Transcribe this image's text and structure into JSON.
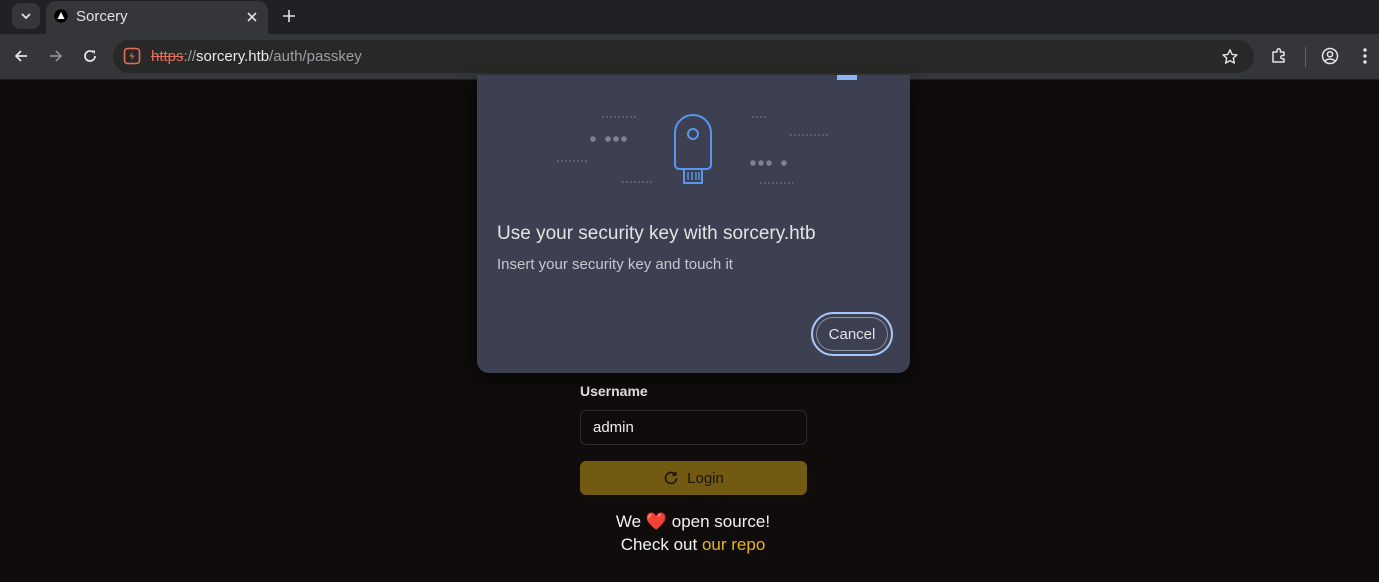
{
  "browser": {
    "tab": {
      "title": "Sorcery"
    },
    "address": {
      "scheme": "https",
      "separator": "://",
      "host": "sorcery.htb",
      "path": "/auth/passkey"
    }
  },
  "login_form": {
    "username_label": "Username",
    "username_value": "admin",
    "login_label": "Login"
  },
  "footer": {
    "line1_before": "We",
    "line1_after": "open source!",
    "line2_before": "Check out",
    "repo_link": "our repo"
  },
  "passkey_dialog": {
    "title": "Use your security key with sorcery.htb",
    "subtitle": "Insert your security key and touch it",
    "cancel_label": "Cancel"
  },
  "icons": {
    "tab_search": "chevron-down-icon",
    "favicon": "triangle-logo-icon",
    "close": "close-icon",
    "new_tab": "plus-icon",
    "back": "arrow-left-icon",
    "forward": "arrow-right-icon",
    "reload": "reload-icon",
    "site_info": "not-secure-icon",
    "bookmark": "star-icon",
    "extensions": "puzzle-icon",
    "profile": "profile-icon",
    "menu": "kebab-menu-icon",
    "login": "spinner-icon",
    "heart": "heart-icon",
    "security_key": "security-key-icon"
  },
  "colors": {
    "accent_link": "#e7b320",
    "login_button": "#725a12",
    "dialog_bg": "#3c4050",
    "focus_ring": "#a8c7fa",
    "url_scheme": "#e46e5c"
  }
}
